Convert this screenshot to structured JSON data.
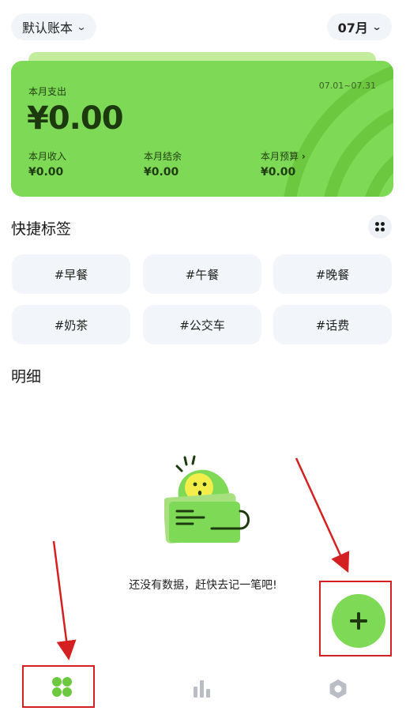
{
  "header": {
    "ledger_label": "默认账本",
    "month_label": "07月"
  },
  "summary": {
    "expense_label": "本月支出",
    "date_range": "07.01~07.31",
    "expense_value": "¥0.00",
    "income_label": "本月收入",
    "income_value": "¥0.00",
    "balance_label": "本月结余",
    "balance_value": "¥0.00",
    "budget_label": "本月预算",
    "budget_value": "¥0.00"
  },
  "quick_tags": {
    "title": "快捷标签",
    "tags": [
      "#早餐",
      "#午餐",
      "#晚餐",
      "#奶茶",
      "#公交车",
      "#话费"
    ]
  },
  "details": {
    "title": "明细",
    "empty_text": "还没有数据，赶快去记一笔吧!"
  },
  "colors": {
    "accent": "#7ed957",
    "accent_dark": "#1c3a0e",
    "highlight_frame": "#d42020",
    "nav_active": "#6cc93f",
    "nav_inactive": "#b9bec5"
  },
  "icons": {
    "fab": "plus-icon",
    "nav_home": "four-dots-icon",
    "nav_stats": "bar-chart-icon",
    "nav_settings": "hexagon-icon",
    "tags_menu": "grid-dots-icon"
  }
}
